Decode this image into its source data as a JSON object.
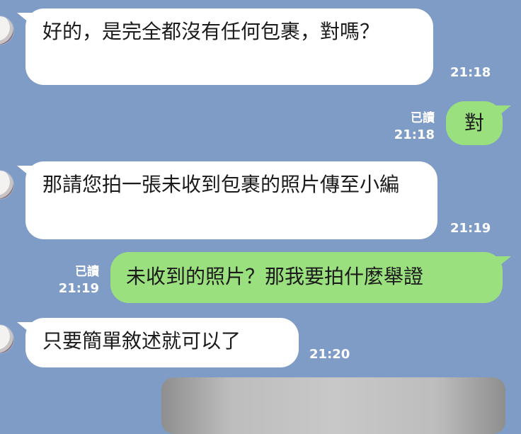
{
  "messages": [
    {
      "text": "好的，是完全都沒有任何包裹，對嗎？",
      "time": "21:18"
    },
    {
      "text": "對",
      "time": "21:18",
      "read": "已讀"
    },
    {
      "text": "那請您拍一張未收到包裹的照片傳至小編",
      "time": "21:19"
    },
    {
      "text": "未收到的照片？那我要拍什麼舉證",
      "time": "21:19",
      "read": "已讀"
    },
    {
      "text": "只要簡單敘述就可以了",
      "time": "21:20"
    }
  ],
  "colors": {
    "background": "#7f9cc7",
    "incoming": "#ffffff",
    "outgoing": "#9be07e"
  }
}
